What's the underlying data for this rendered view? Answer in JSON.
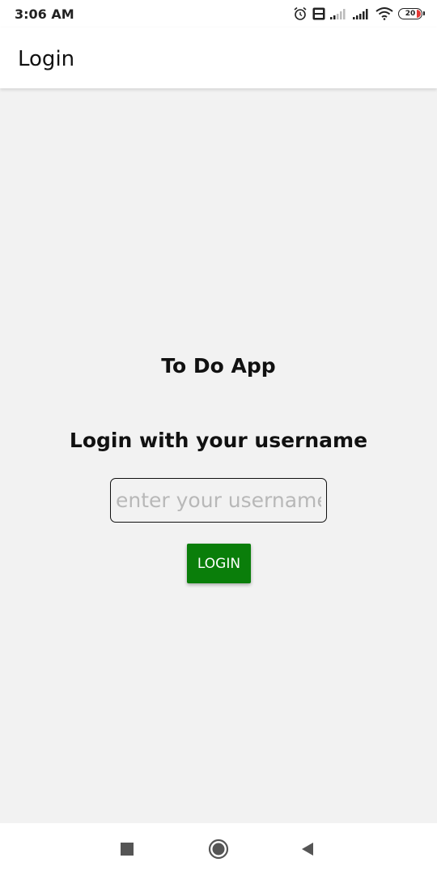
{
  "status_bar": {
    "time": "3:06 AM",
    "battery_level": "20",
    "icons": [
      "alarm-icon",
      "volte-icon",
      "signal-icon",
      "signal-icon",
      "wifi-icon",
      "battery-icon"
    ]
  },
  "app_bar": {
    "title": "Login"
  },
  "main": {
    "app_name": "To Do App",
    "login_heading": "Login with your username",
    "username_placeholder": "enter your username",
    "username_value": "",
    "login_button_label": "LOGIN"
  },
  "colors": {
    "login_button": "#0a7e0a",
    "background": "#f2f2f2",
    "battery_low": "#e53935"
  },
  "nav_bar": {
    "icons": [
      "recents-icon",
      "home-icon",
      "back-icon"
    ]
  }
}
